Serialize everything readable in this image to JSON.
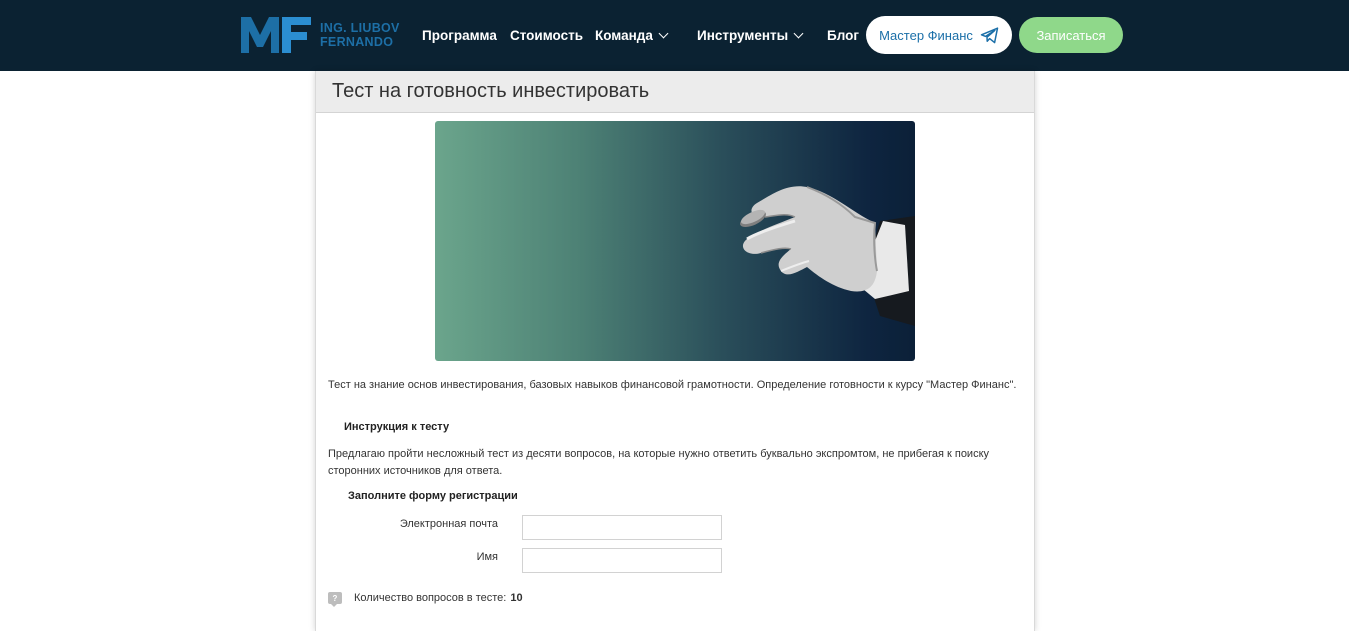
{
  "header": {
    "logo_line1": "ING. LIUBOV",
    "logo_line2": "FERNANDO",
    "logo_mark": "MF",
    "nav": {
      "program": "Программа",
      "price": "Стоимость",
      "team": "Команда",
      "tools": "Инструменты",
      "blog": "Блог"
    },
    "telegram_button": "Мастер Финанс",
    "signup_button": "Записаться",
    "colors": {
      "bar": "#0b2232",
      "signup": "#8fd88a",
      "brand": "#1d6fa6"
    }
  },
  "page": {
    "title": "Тест на готовность инвестировать",
    "description": "Тест на знание основ инвестирования, базовых навыков финансовой грамотности. Определение готовности к курсу \"Мастер Финанс\".",
    "instruction_heading": "Инструкция к тесту",
    "instruction_text": "Предлагаю пройти несложный тест из десяти вопросов, на которые нужно ответить буквально экспромтом, не прибегая к поиску сторонних источников для ответа.",
    "form_heading": "Заполните форму регистрации",
    "form": {
      "email_label": "Электронная почта",
      "email_value": "",
      "name_label": "Имя",
      "name_value": ""
    },
    "question_count_label": "Количество вопросов в тесте:",
    "question_count_value": "10",
    "question_icon_glyph": "?"
  }
}
